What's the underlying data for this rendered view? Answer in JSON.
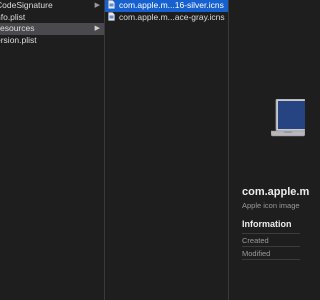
{
  "column1": {
    "items": [
      {
        "label": "CodeSignature",
        "selected": false,
        "has_children": true
      },
      {
        "label": "nfo.plist",
        "selected": false,
        "has_children": false
      },
      {
        "label": "esources",
        "selected": true,
        "has_children": true
      },
      {
        "label": "ersion.plist",
        "selected": false,
        "has_children": false
      }
    ]
  },
  "column2": {
    "items": [
      {
        "label": "com.apple.m...16-silver.icns",
        "selected": true,
        "icon": "icns-file-icon"
      },
      {
        "label": "com.apple.m...ace-gray.icns",
        "selected": false,
        "icon": "icns-file-icon"
      }
    ]
  },
  "preview": {
    "title": "com.apple.m",
    "kind": "Apple icon image",
    "info_heading": "Information",
    "rows": [
      {
        "label": "Created"
      },
      {
        "label": "Modified"
      }
    ],
    "icon": "macbook-laptop-icon"
  },
  "colors": {
    "background": "#1e1e1e",
    "selection_active": "#1660d0",
    "selection_inactive": "#4a4a4e"
  }
}
